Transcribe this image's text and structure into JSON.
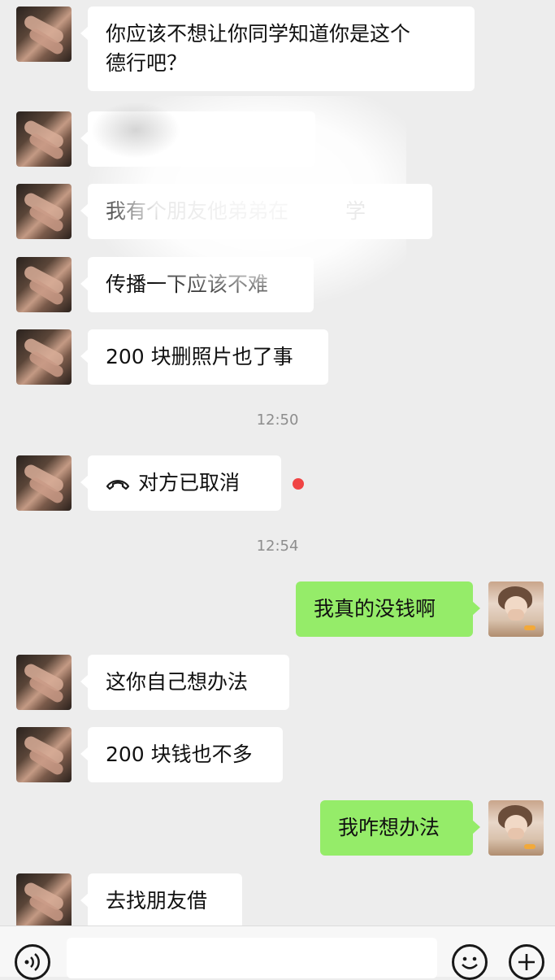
{
  "conversation": {
    "messages": [
      {
        "side": "other",
        "text": "你应该不想让你同学知道你是这个\n德行吧？"
      },
      {
        "side": "other",
        "text": "",
        "censored": true
      },
      {
        "side": "other",
        "text": "我有个朋友他弟弟在",
        "text_after": "学"
      },
      {
        "side": "other",
        "text": "传播一下应该不难"
      },
      {
        "side": "other",
        "text": "200 块删照片也了事"
      },
      {
        "time": "12:50"
      },
      {
        "side": "other",
        "call": true,
        "text": "对方已取消"
      },
      {
        "time": "12:54"
      },
      {
        "side": "me",
        "text": "我真的没钱啊"
      },
      {
        "side": "other",
        "text": "这你自己想办法"
      },
      {
        "side": "other",
        "text": "200 块钱也不多"
      },
      {
        "side": "me",
        "text": "我咋想办法"
      },
      {
        "side": "other",
        "text": "去找朋友借"
      }
    ]
  },
  "input_bar": {
    "placeholder": "",
    "voice_icon": "voice-icon",
    "emoji_icon": "emoji-icon",
    "plus_icon": "plus-icon"
  },
  "colors": {
    "background": "#ededed",
    "bubble_other": "#ffffff",
    "bubble_me": "#95ec69",
    "unread_dot": "#f04444"
  }
}
